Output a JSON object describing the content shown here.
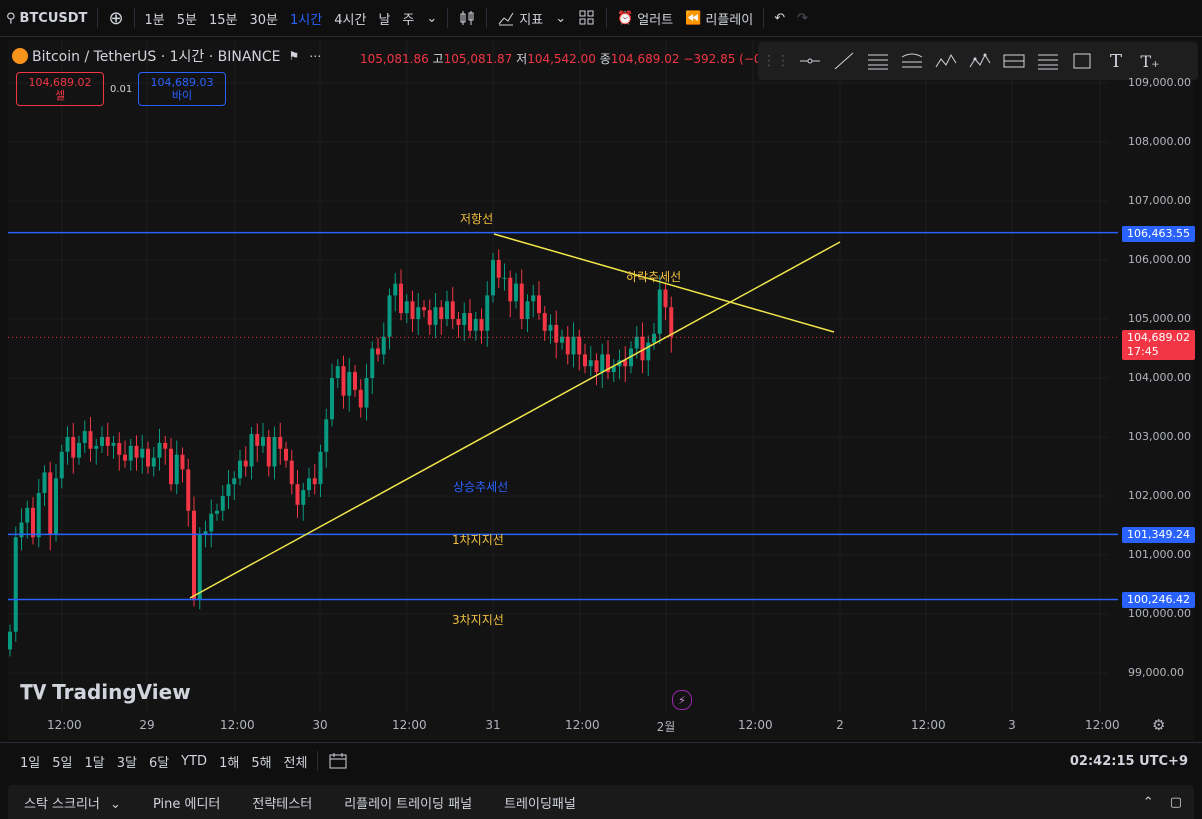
{
  "topbar": {
    "symbol": "BTCUSDT",
    "intervals": [
      "1분",
      "5분",
      "15분",
      "30분",
      "1시간",
      "4시간",
      "날",
      "주"
    ],
    "active_interval": "1시간",
    "indicators_label": "지표",
    "alert_label": "얼러트",
    "replay_label": "리플레이"
  },
  "legend": {
    "title": "Bitcoin / TetherUS · 1시간 · BINANCE",
    "o_label": "",
    "o_value": "105,081.86",
    "h_label": "고",
    "h_value": "105,081.87",
    "l_label": "저",
    "l_value": "104,542.00",
    "c_label": "종",
    "c_value": "104,689.02",
    "change": "−392.85 (−0.",
    "sell_price": "104,689.02",
    "sell_label": "셀",
    "spread": "0.01",
    "buy_price": "104,689.03",
    "buy_label": "바이"
  },
  "price_scale": {
    "ticks": [
      "109,000.00",
      "108,000.00",
      "107,000.00",
      "106,000.00",
      "105,000.00",
      "104,000.00",
      "103,000.00",
      "102,000.00",
      "101,000.00",
      "100,000.00",
      "99,000.00"
    ],
    "resistance": "106,463.55",
    "support1": "101,349.24",
    "support3": "100,246.42",
    "current_price": "104,689.02",
    "countdown": "17:45"
  },
  "time_axis": {
    "labels": [
      "12:00",
      "29",
      "12:00",
      "30",
      "12:00",
      "31",
      "12:00",
      "2월",
      "12:00",
      "2",
      "12:00",
      "3",
      "12:00"
    ]
  },
  "annotations": {
    "resistance": "저항선",
    "downtrend": "하락추세선",
    "uptrend": "상승추세선",
    "support1": "1차지지선",
    "support3": "3차지지선"
  },
  "brand": "TradingView",
  "bottombar": {
    "ranges": [
      "1일",
      "5일",
      "1달",
      "3달",
      "6달",
      "YTD",
      "1해",
      "5해",
      "전체"
    ],
    "clock": "02:42:15 UTC+9"
  },
  "panels": [
    "스탁 스크리너",
    "Pine 에디터",
    "전략테스터",
    "리플레이 트레이딩 패널",
    "트레이딩패널"
  ],
  "colors": {
    "up": "#089981",
    "down": "#f23645",
    "line_blue": "#2962ff",
    "line_yellow": "#f0e44a",
    "label_yellow": "#f0c040",
    "label_blue": "#2962ff"
  }
}
